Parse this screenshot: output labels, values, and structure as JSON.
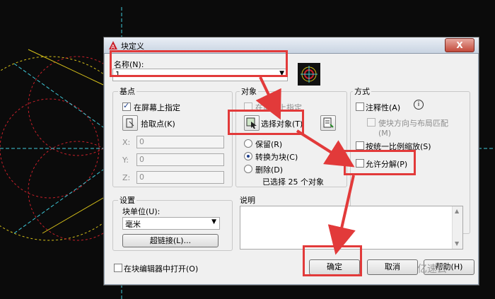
{
  "dialog": {
    "title": "块定义",
    "close_label": "X"
  },
  "name": {
    "label": "名称(N):",
    "value": "1"
  },
  "base_point": {
    "title": "基点",
    "specify_on_screen": "在屏幕上指定",
    "pick_point": "拾取点(K)",
    "x_label": "X:",
    "y_label": "Y:",
    "z_label": "Z:",
    "x_value": "0",
    "y_value": "0",
    "z_value": "0"
  },
  "objects": {
    "title": "对象",
    "specify_on_screen": "在屏幕上指定",
    "select_objects": "选择对象(T)",
    "retain": "保留(R)",
    "convert_to_block": "转换为块(C)",
    "delete": "删除(D)",
    "selected_count": "已选择 25 个对象"
  },
  "behavior": {
    "title": "方式",
    "annotative": "注释性(A)",
    "match_orientation": "使块方向与布局匹配(M)",
    "scale_uniformly": "按统一比例缩放(S)",
    "allow_exploding": "允许分解(P)"
  },
  "settings": {
    "title": "设置",
    "block_unit_label": "块单位(U):",
    "block_unit_value": "毫米",
    "hyperlink_button": "超链接(L)..."
  },
  "description": {
    "title": "说明"
  },
  "footer": {
    "open_in_editor": "在块编辑器中打开(O)",
    "ok": "确定",
    "cancel": "取消",
    "help": "帮助(H)",
    "watermark": "亿速云"
  },
  "colors": {
    "annotation_red": "#e23a3a",
    "cad_yellow": "#d6c01a",
    "cad_red": "#c8202a",
    "cad_cyan": "#3fc8d8"
  }
}
